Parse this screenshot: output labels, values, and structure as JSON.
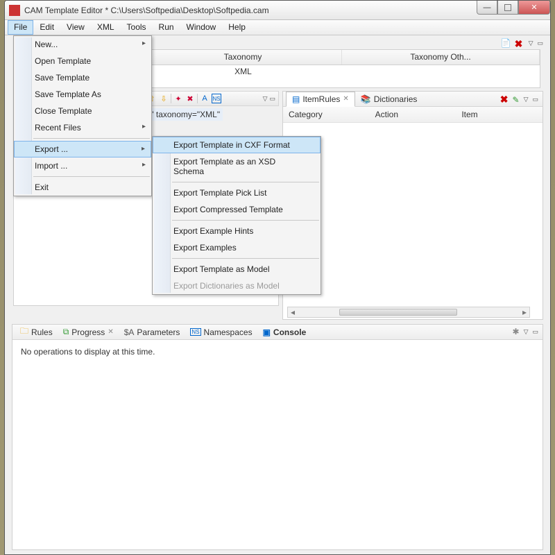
{
  "titlebar": {
    "title": "CAM Template Editor * C:\\Users\\Softpedia\\Desktop\\Softpedia.cam"
  },
  "menubar": [
    "File",
    "Edit",
    "View",
    "XML",
    "Tools",
    "Run",
    "Window",
    "Help"
  ],
  "file_menu": {
    "new": "New...",
    "open": "Open Template",
    "save": "Save Template",
    "saveas": "Save Template As",
    "close": "Close Template",
    "recent": "Recent Files",
    "export": "Export ...",
    "import": "Import ...",
    "exit": "Exit"
  },
  "export_menu": {
    "cxf": "Export Template in CXF Format",
    "xsd": "Export Template as an XSD Schema",
    "pick": "Export Template Pick List",
    "compressed": "Export Compressed Template",
    "hints": "Export Example Hints",
    "examples": "Export Examples",
    "model": "Export Template as Model",
    "dict": "Export Dictionaries as Model"
  },
  "table": {
    "headers": [
      "Taxonomy",
      "Taxonomy Oth..."
    ],
    "row": [
      "XML",
      ""
    ]
  },
  "snippet_text": "ef=\"\" taxonomy=\"XML\"",
  "right_panel": {
    "tabs": {
      "rules": "ItemRules",
      "dict": "Dictionaries"
    },
    "headers": [
      "Category",
      "Action",
      "Item"
    ]
  },
  "bottom_panel": {
    "tabs": {
      "rules": "Rules",
      "progress": "Progress",
      "params": "Parameters",
      "ns": "Namespaces",
      "console": "Console"
    },
    "message": "No operations to display at this time."
  }
}
